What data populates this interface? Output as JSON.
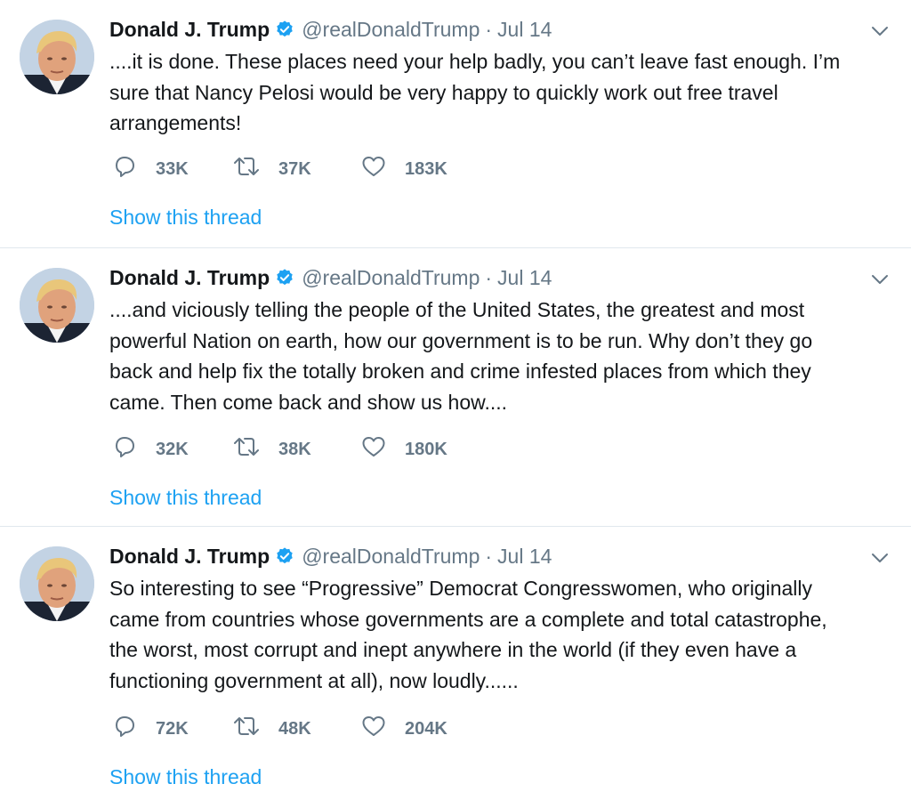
{
  "colors": {
    "link": "#1da1f2",
    "secondary": "#657786",
    "text": "#14171a",
    "divider": "#e1e8ed",
    "verified": "#1da1f2"
  },
  "tweets": [
    {
      "name": "Donald J. Trump",
      "handle": "@realDonaldTrump",
      "separator": "·",
      "date": "Jul 14",
      "lines": [
        "....it is done. These places need your help badly, you can’t leave fast enough. I’m",
        "sure that Nancy Pelosi would be very happy to quickly work out free travel",
        "arrangements!"
      ],
      "replies": "33K",
      "retweets": "37K",
      "likes": "183K",
      "thread_link": "Show this thread"
    },
    {
      "name": "Donald J. Trump",
      "handle": "@realDonaldTrump",
      "separator": "·",
      "date": "Jul 14",
      "lines": [
        "....and viciously telling the people of the United States, the greatest and most",
        "powerful Nation on earth, how our government is to be run. Why don’t they go",
        "back and help fix the totally broken and crime infested places from which they",
        "came. Then come back and show us how...."
      ],
      "replies": "32K",
      "retweets": "38K",
      "likes": "180K",
      "thread_link": "Show this thread"
    },
    {
      "name": "Donald J. Trump",
      "handle": "@realDonaldTrump",
      "separator": "·",
      "date": "Jul 14",
      "lines": [
        "So interesting to see “Progressive” Democrat Congresswomen, who originally",
        "came from countries whose governments are a complete and total catastrophe,",
        "the worst, most corrupt and inept anywhere in the world (if they even have a",
        "functioning government at all), now loudly......"
      ],
      "replies": "72K",
      "retweets": "48K",
      "likes": "204K",
      "thread_link": "Show this thread"
    }
  ],
  "icons": {
    "avatar": "profile-photo",
    "verified": "verified-badge-icon",
    "caret": "chevron-down-icon",
    "reply": "reply-icon",
    "retweet": "retweet-icon",
    "like": "heart-icon"
  }
}
